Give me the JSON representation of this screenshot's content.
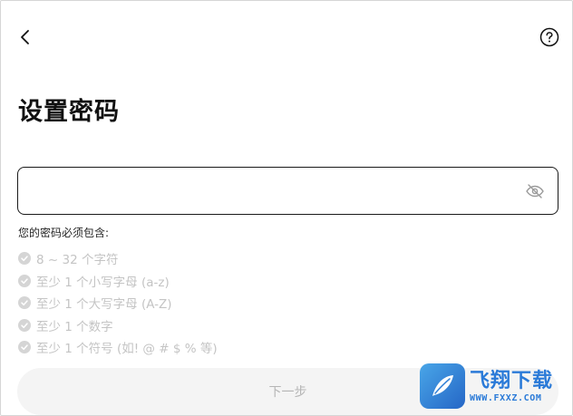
{
  "page": {
    "title": "设置密码"
  },
  "password": {
    "value": "",
    "placeholder": ""
  },
  "requirements": {
    "heading": "您的密码必须包含:",
    "items": [
      "8 ~ 32 个字符",
      "至少 1 个小写字母 (a-z)",
      "至少 1 个大写字母 (A-Z)",
      "至少 1 个数字",
      "至少 1 个符号 (如! @ # $ % 等)"
    ]
  },
  "actions": {
    "next_label": "下一步"
  },
  "watermark": {
    "title": "飞翔下载",
    "url": "WWW.FXXZ.COM"
  },
  "icons": {
    "back": "chevron-left-icon",
    "help": "question-circle-icon",
    "visibility": "eye-off-icon",
    "check": "check-circle-icon"
  },
  "colors": {
    "text_primary": "#111111",
    "disabled_text": "#c4c4c4",
    "button_bg": "#f4f4f4",
    "watermark": "#2a7ad8"
  }
}
